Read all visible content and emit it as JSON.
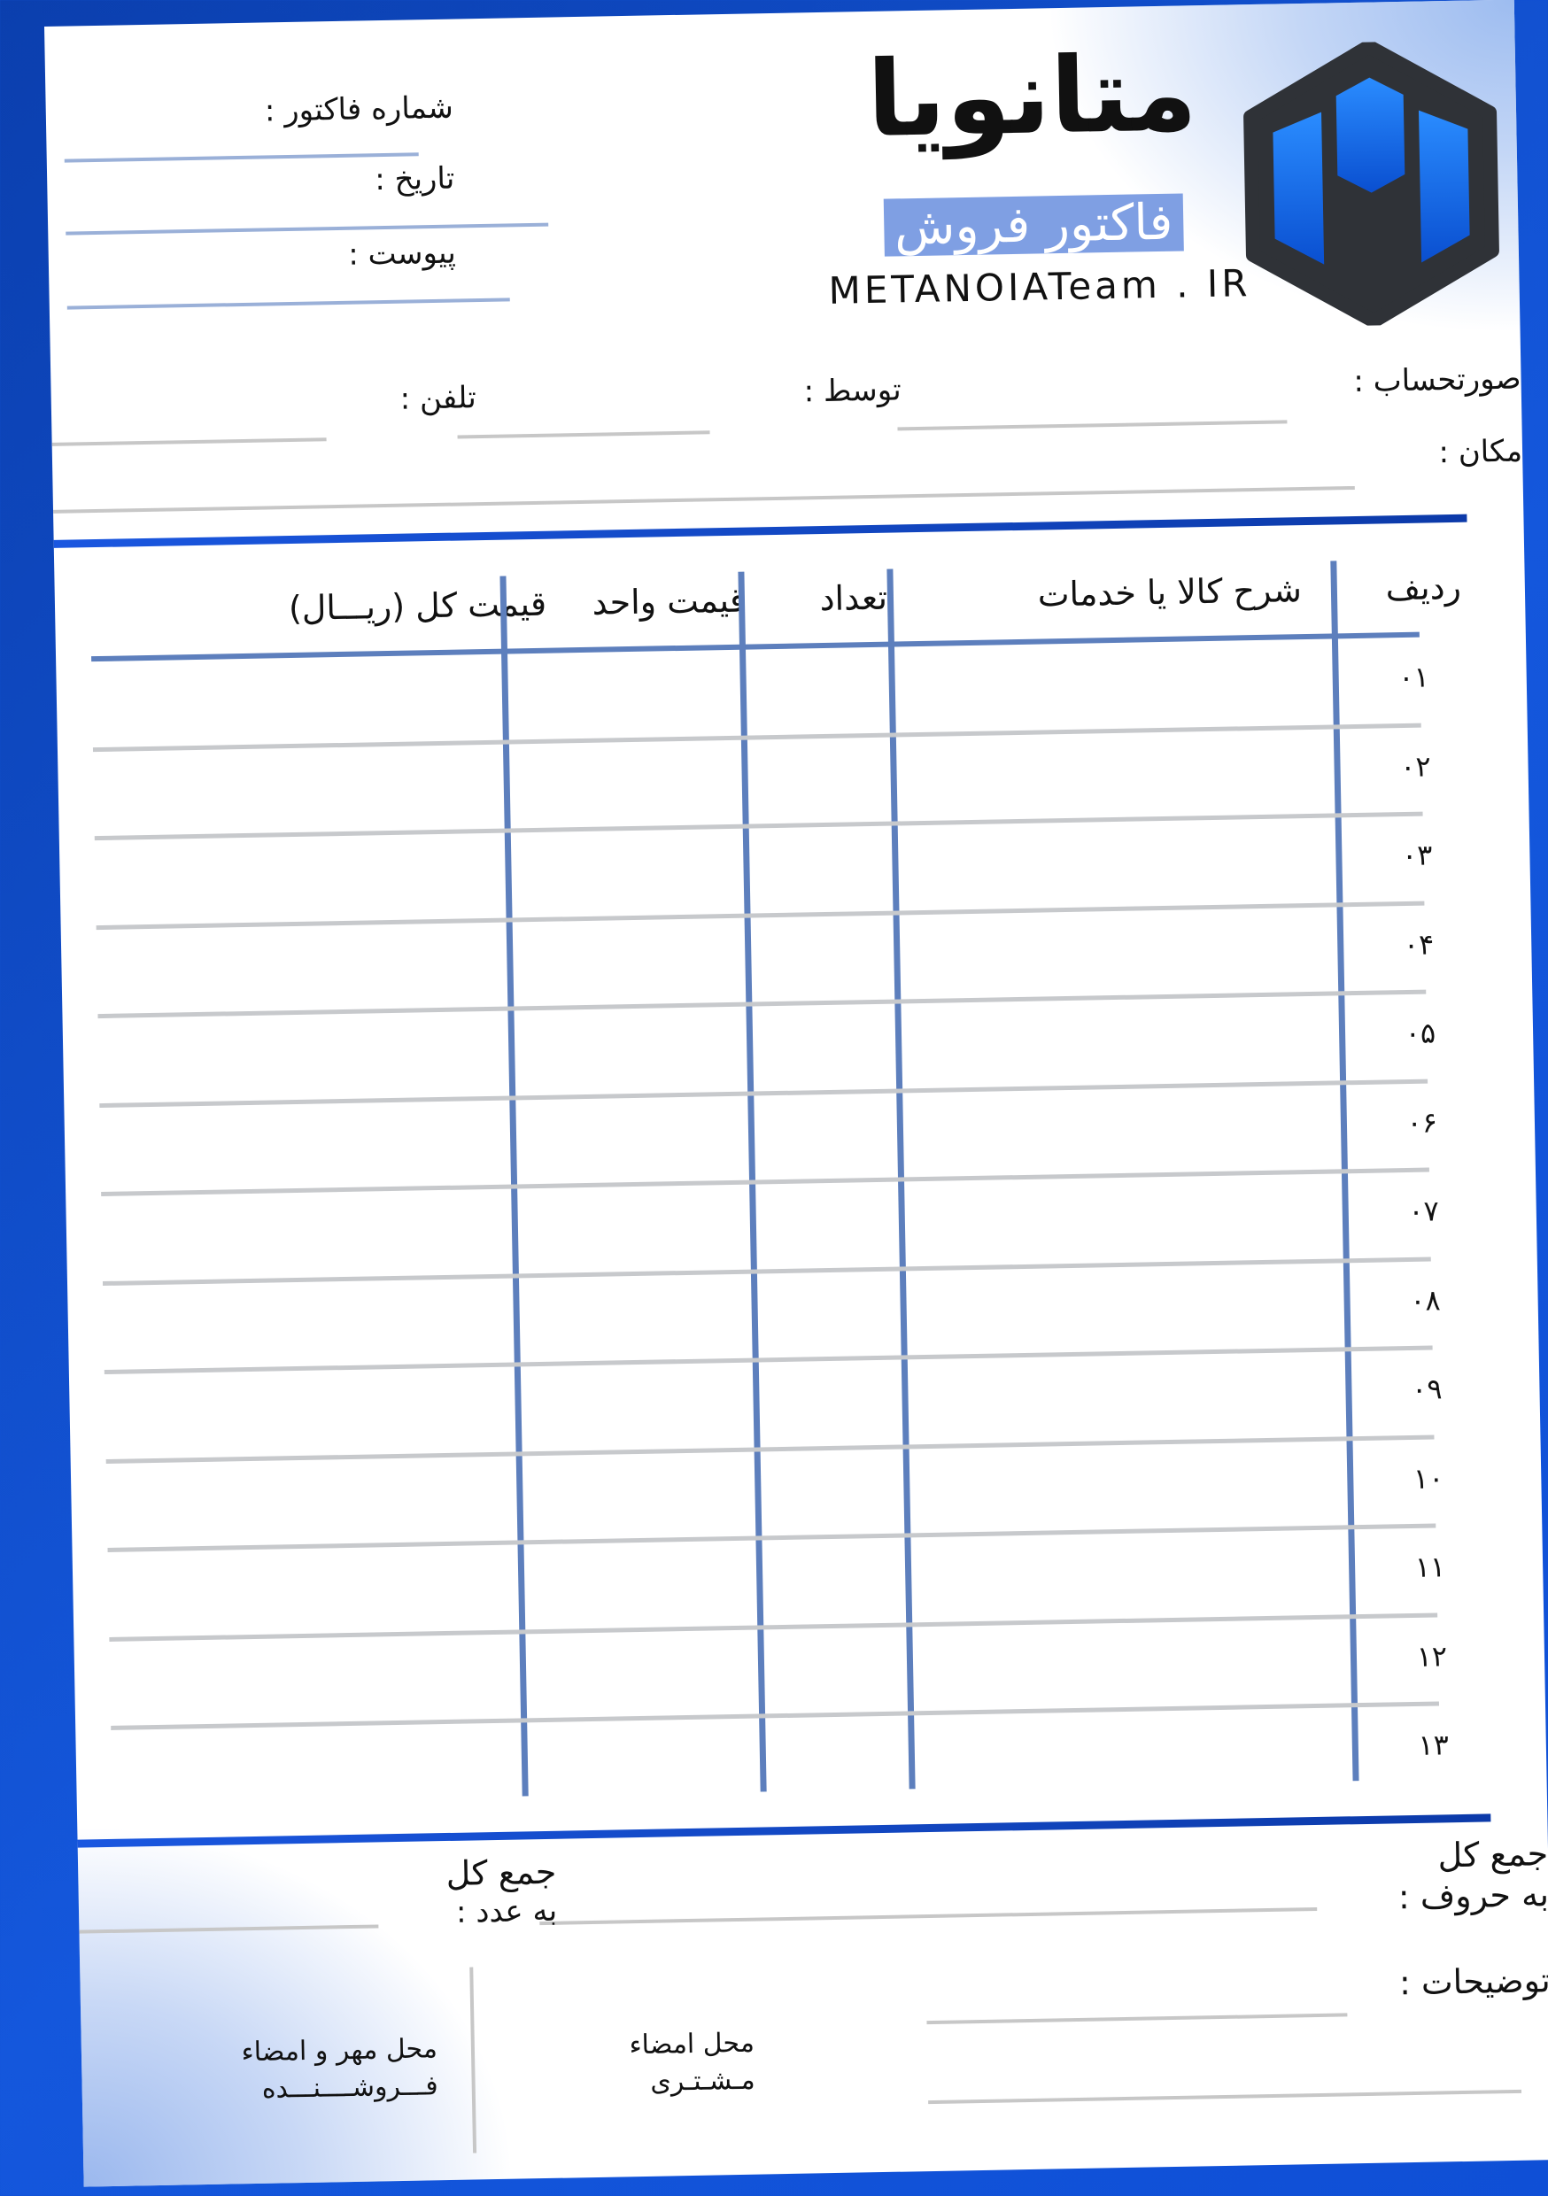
{
  "header": {
    "brand_fa": "متانویا",
    "subtitle": "فاکتور فروش",
    "website": "METANOIATeam . IR",
    "fields": {
      "invoice_number": "شماره فاکتور :",
      "date": "تاریخ :",
      "attachment": "پیوست :"
    }
  },
  "info": {
    "account": "صورتحساب :",
    "by": "توسط :",
    "phone": "تلفن :",
    "location": "مکان :"
  },
  "table": {
    "columns": [
      "ردیف",
      "شرح کالا یا خدمات",
      "تعداد",
      "قیمت واحد",
      "قیمت کل (ریـــال)"
    ],
    "row_numbers": [
      "۰۱",
      "۰۲",
      "۰۳",
      "۰۴",
      "۰۵",
      "۰۶",
      "۰۷",
      "۰۸",
      "۰۹",
      "۱۰",
      "۱۱",
      "۱۲",
      "۱۳"
    ]
  },
  "totals": {
    "total_words_line1": "جمع کل",
    "total_words_line2": "به حروف :",
    "total_number_line1": "جمع کل",
    "total_number_line2": "به عدد :"
  },
  "footer": {
    "notes": "توضیحات :",
    "customer_sig_line1": "محل امضاء",
    "customer_sig_line2": "مـشـتـری",
    "seller_sig_line1": "محل مهر و امضاء",
    "seller_sig_line2": "فـــروشــــنـــده"
  },
  "colors": {
    "accent": "#1457dc",
    "logo_bg": "#2f3237",
    "table_rule": "#5d7fbd"
  }
}
